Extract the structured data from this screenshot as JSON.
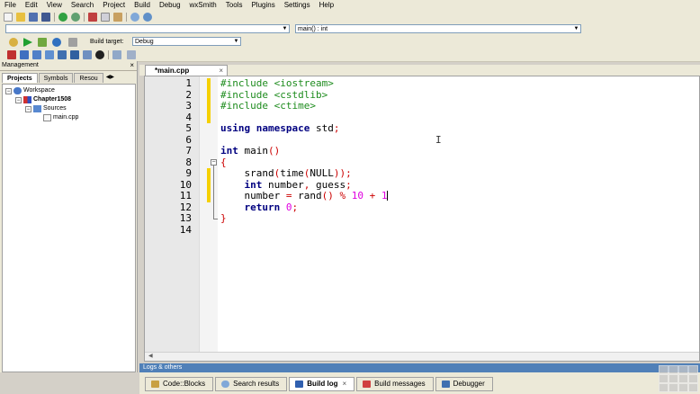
{
  "menu": [
    "File",
    "Edit",
    "View",
    "Search",
    "Project",
    "Build",
    "Debug",
    "wxSmith",
    "Tools",
    "Plugins",
    "Settings",
    "Help"
  ],
  "toolbar": {
    "function_combo": "main() : int",
    "build_target_label": "Build target:",
    "build_target_value": "Debug"
  },
  "management": {
    "title": "Management",
    "close": "×",
    "tabs": [
      "Projects",
      "Symbols",
      "Resou"
    ],
    "tree": {
      "workspace": "Workspace",
      "project": "Chapter1508",
      "folder": "Sources",
      "file": "main.cpp"
    }
  },
  "editor": {
    "tab_label": "*main.cpp",
    "tab_close": "×",
    "line_numbers": [
      "1",
      "2",
      "3",
      "4",
      "5",
      "6",
      "7",
      "8",
      "9",
      "10",
      "11",
      "12",
      "13",
      "14"
    ]
  },
  "logs": {
    "title": "Logs & others",
    "tabs": [
      "Code::Blocks",
      "Search results",
      "Build log",
      "Build messages",
      "Debugger"
    ],
    "active_tab": "Build log",
    "close": "×"
  },
  "colors": {
    "preprocessor": "#1e8c1e",
    "keyword": "#000080",
    "number": "#e000e0",
    "changed_marker": "#f5d000"
  }
}
